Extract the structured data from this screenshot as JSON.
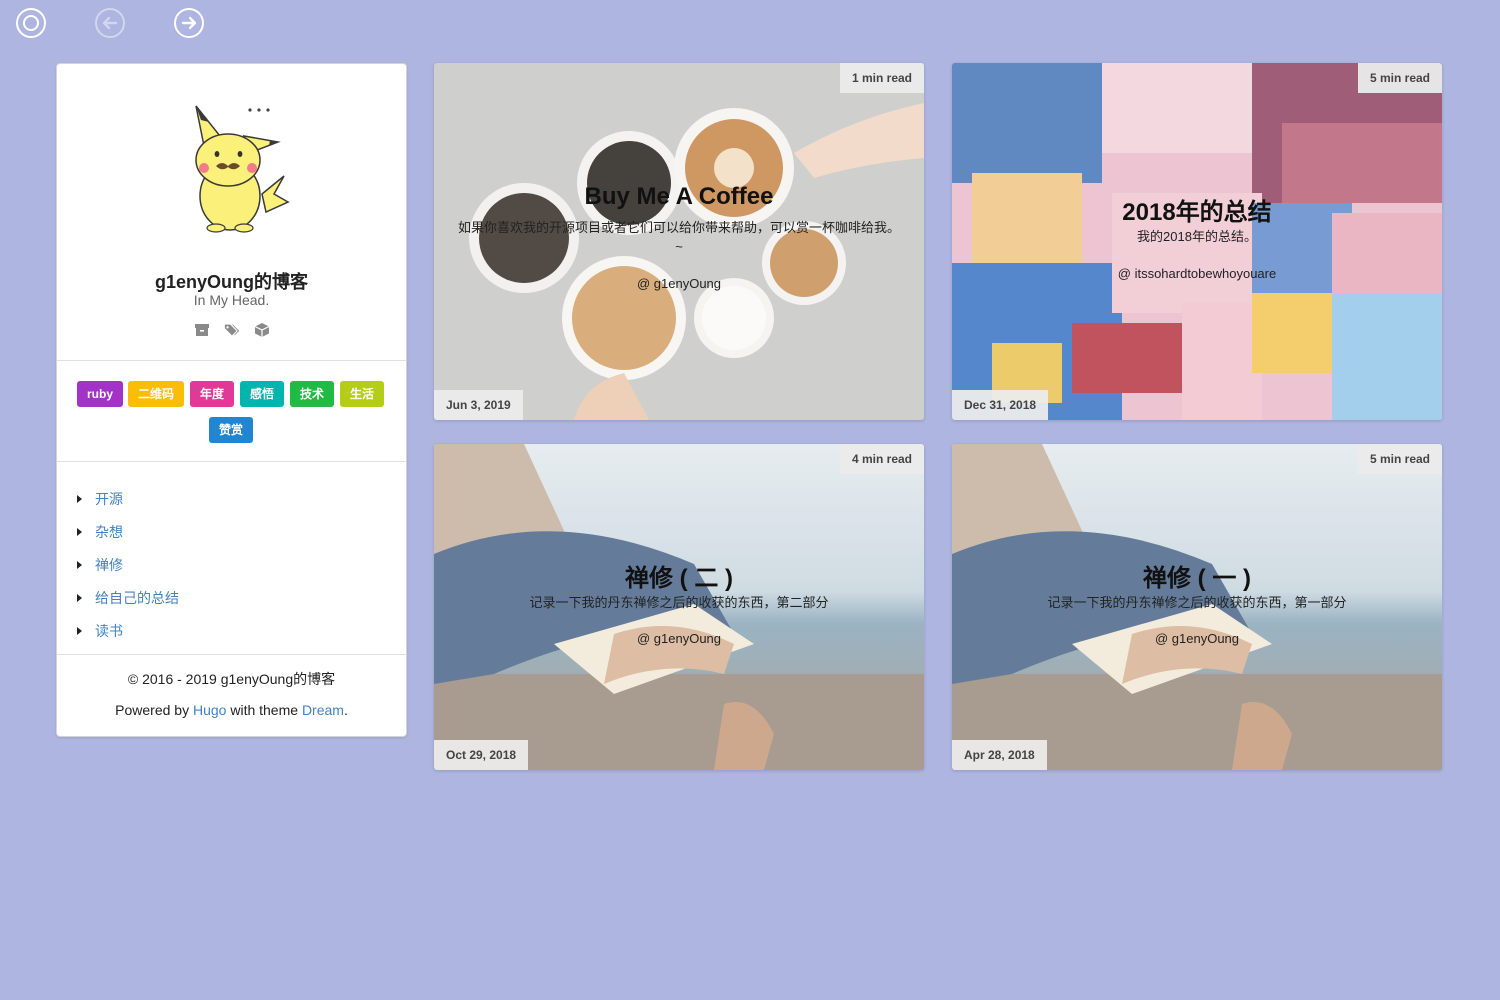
{
  "nav": {
    "home_icon": "home-circle-icon",
    "back_icon": "arrow-left-circle-icon",
    "forward_icon": "arrow-right-circle-icon"
  },
  "profile": {
    "title": "g1enyOung的博客",
    "subtitle": "In My Head.",
    "icons": [
      "archive-icon",
      "tags-icon",
      "cube-icon"
    ]
  },
  "tags": [
    {
      "label": "ruby",
      "color": "#a333c8"
    },
    {
      "label": "二维码",
      "color": "#fbbd08"
    },
    {
      "label": "年度",
      "color": "#e03997"
    },
    {
      "label": "感悟",
      "color": "#00b5ad"
    },
    {
      "label": "技术",
      "color": "#21ba45"
    },
    {
      "label": "生活",
      "color": "#b5cc18"
    },
    {
      "label": "赞赏",
      "color": "#2185d0"
    }
  ],
  "categories": [
    "开源",
    "杂想",
    "禅修",
    "给自己的总结",
    "读书"
  ],
  "footer": {
    "copyright": "© 2016 - 2019 g1enyOung的博客",
    "powered_prefix": "Powered by",
    "hugo": "Hugo",
    "with_theme": "with theme",
    "dream": "Dream",
    "period": "."
  },
  "posts": [
    {
      "title": "Buy Me A Coffee",
      "desc": "如果你喜欢我的开源项目或者它们可以给你带来帮助，可以赏一杯咖啡给我。~",
      "author": "@ g1enyOung",
      "readtime": "1 min read",
      "date": "Jun 3, 2019"
    },
    {
      "title": "2018年的总结",
      "desc": "我的2018年的总结。",
      "author": "@ itssohardtobewhoyouare",
      "readtime": "5 min read",
      "date": "Dec 31, 2018"
    },
    {
      "title": "禅修 ( 二 )",
      "desc": "记录一下我的丹东禅修之后的收获的东西，第二部分",
      "author": "@ g1enyOung",
      "readtime": "4 min read",
      "date": "Oct 29, 2018"
    },
    {
      "title": "禅修 ( 一 )",
      "desc": "记录一下我的丹东禅修之后的收获的东西，第一部分",
      "author": "@ g1enyOung",
      "readtime": "5 min read",
      "date": "Apr 28, 2018"
    }
  ],
  "colors": {
    "background": "#adb5e0",
    "link": "#4183c4"
  }
}
